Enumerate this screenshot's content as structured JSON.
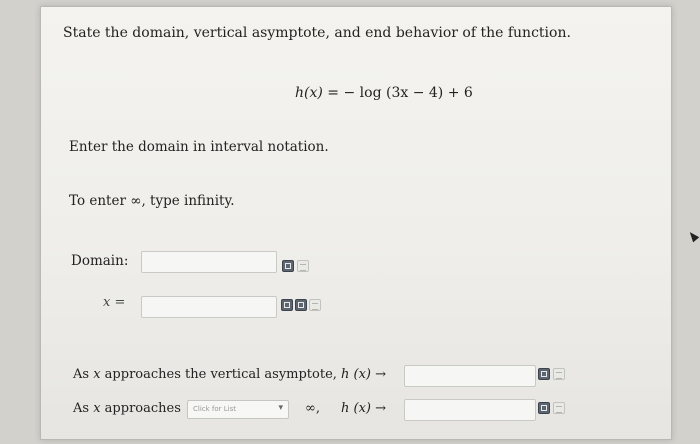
{
  "question": {
    "prompt": "State the domain, vertical asymptote, and end behavior of the function.",
    "function_lhs": "h",
    "function_arg": "(x)",
    "function_rhs": " = − log (3x − 4) + 6"
  },
  "domain_section": {
    "instruction": "Enter the domain in interval notation.",
    "infinity_hint": "To enter ∞, type infinity.",
    "domain_label": "Domain:",
    "domain_value": "",
    "asymptote_label": "x =",
    "asymptote_value": ""
  },
  "end_behavior": {
    "row1_prefix": "As ",
    "row1_var": "x",
    "row1_suffix": " approaches the vertical asymptote,",
    "row1_hx": "h (x) →",
    "row1_value": "",
    "row2_prefix": "As ",
    "row2_var": "x",
    "row2_suffix": " approaches",
    "row2_select_placeholder": "Click for List",
    "row2_after_select": "∞,",
    "row2_hx": "h (x) →",
    "row2_value": ""
  },
  "icons": {
    "equation_editor": "equation-editor-icon",
    "preview": "preview-icon"
  }
}
